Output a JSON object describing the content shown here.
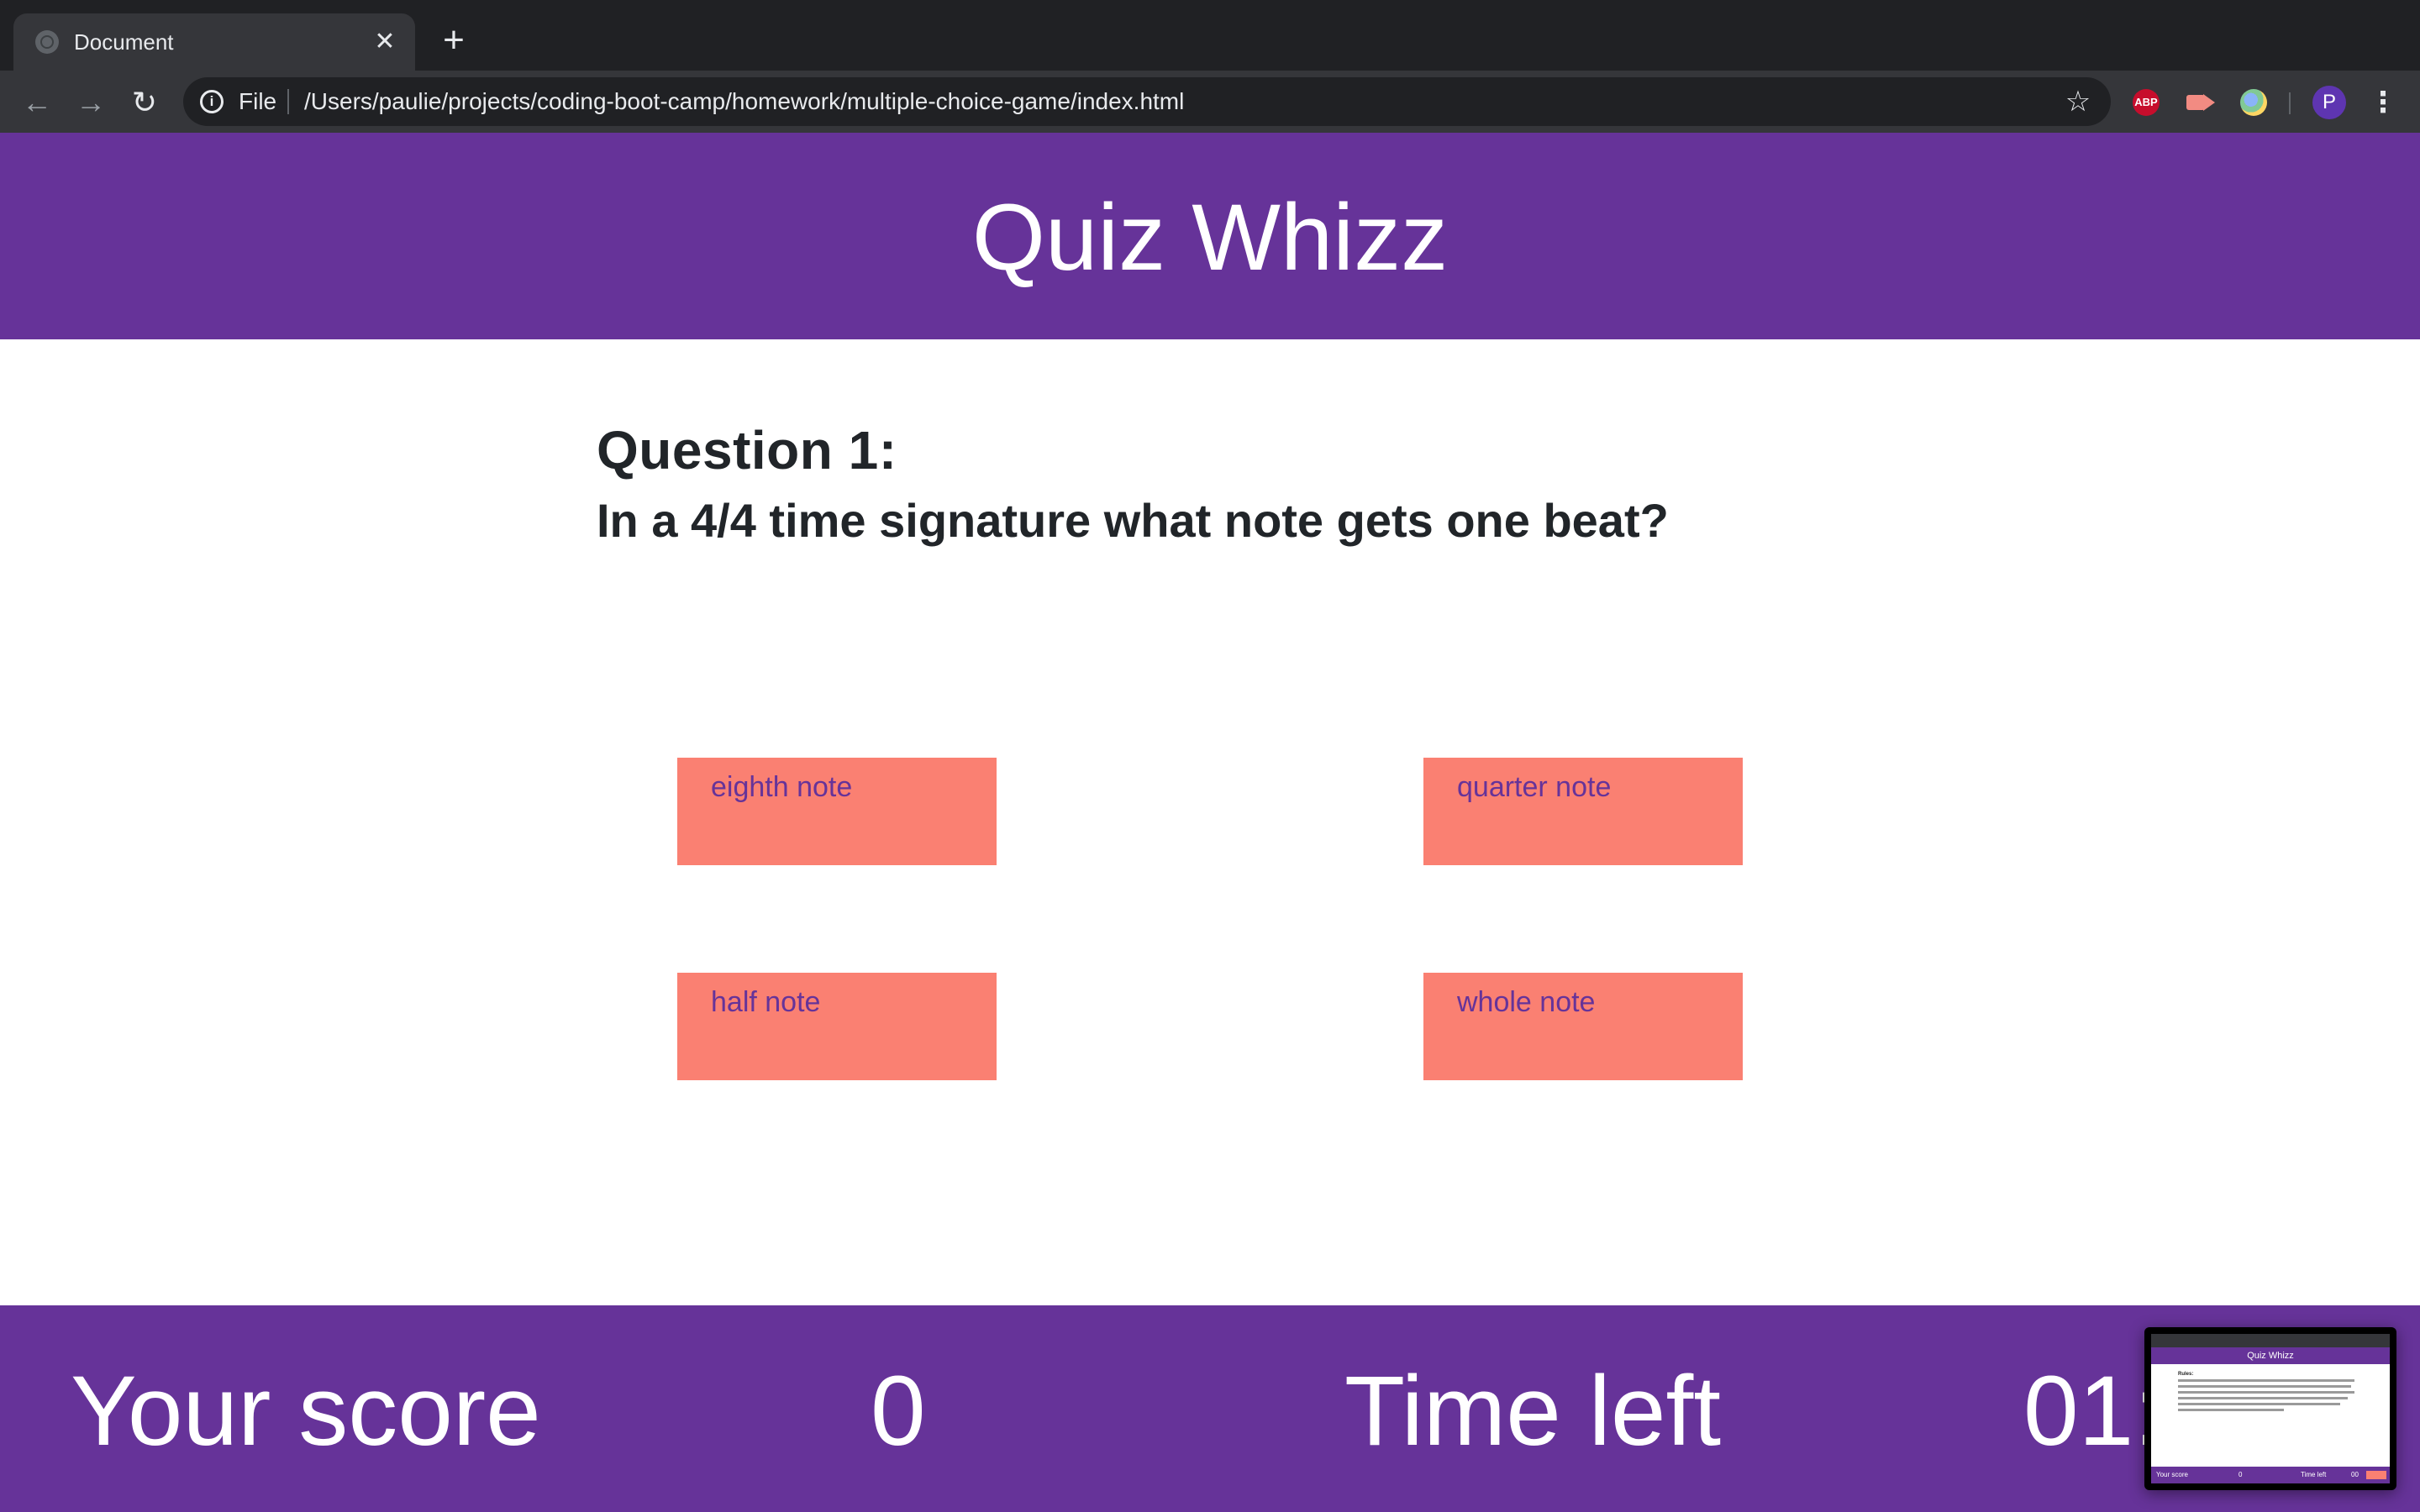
{
  "browser": {
    "tab_title": "Document",
    "tab_close_glyph": "✕",
    "new_tab_glyph": "+",
    "url_scheme": "File",
    "url_path": "/Users/paulie/projects/coding-boot-camp/homework/multiple-choice-game/index.html",
    "extension_abp_label": "ABP",
    "profile_initial": "P",
    "icons": {
      "back": "arrow-left-icon",
      "forward": "arrow-right-icon",
      "reload": "reload-icon",
      "info": "info-icon",
      "bookmark": "star-icon",
      "menu": "kebab-menu-icon"
    }
  },
  "header": {
    "title": "Quiz Whizz"
  },
  "question": {
    "number_label": "Question 1:",
    "text": "In a 4/4 time signature what note gets one beat?"
  },
  "answers": [
    {
      "label": "eighth note"
    },
    {
      "label": "quarter note"
    },
    {
      "label": "half note"
    },
    {
      "label": "whole note"
    }
  ],
  "footer": {
    "score_label": "Your score",
    "score_value": "0",
    "time_label": "Time left",
    "time_value": "01:"
  },
  "thumbnail": {
    "header_title": "Quiz Whizz",
    "rules_label": "Rules:",
    "score_label": "Your score",
    "score_value": "0",
    "time_label": "Time left",
    "time_value": "00"
  },
  "colors": {
    "brand_purple": "#663399",
    "answer_salmon": "#fa8072",
    "text_dark": "#212529",
    "chrome_dark": "#202124",
    "chrome_toolbar": "#35363a"
  }
}
